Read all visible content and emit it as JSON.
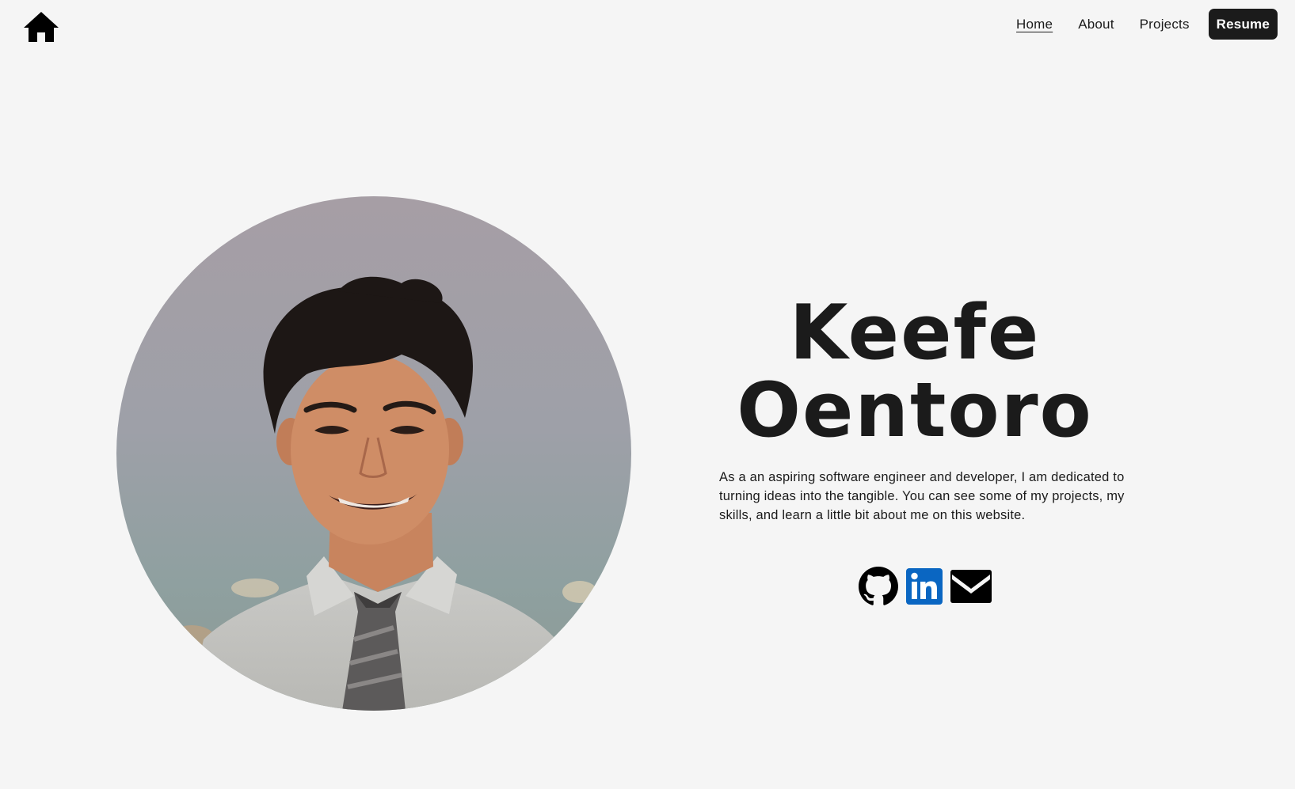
{
  "nav": {
    "home_icon": "home-icon",
    "items": [
      {
        "label": "Home",
        "active": true
      },
      {
        "label": "About",
        "active": false
      },
      {
        "label": "Projects",
        "active": false
      }
    ],
    "resume_label": "Resume"
  },
  "hero": {
    "first_name": "Keefe",
    "last_name": "Oentoro",
    "bio": "As a an aspiring software engineer and developer, I am dedicated to turning ideas into the tangible. You can see some of my projects, my skills, and learn a little bit about me on this website.",
    "portrait_icon": "profile-photo",
    "socials": [
      {
        "icon": "github-icon"
      },
      {
        "icon": "linkedin-icon",
        "color": "#0a66c2"
      },
      {
        "icon": "email-icon"
      }
    ]
  },
  "colors": {
    "background": "#f5f5f5",
    "text": "#1b1b1b",
    "button_bg": "#1b1b1b",
    "button_text": "#ffffff",
    "linkedin": "#0a66c2"
  }
}
